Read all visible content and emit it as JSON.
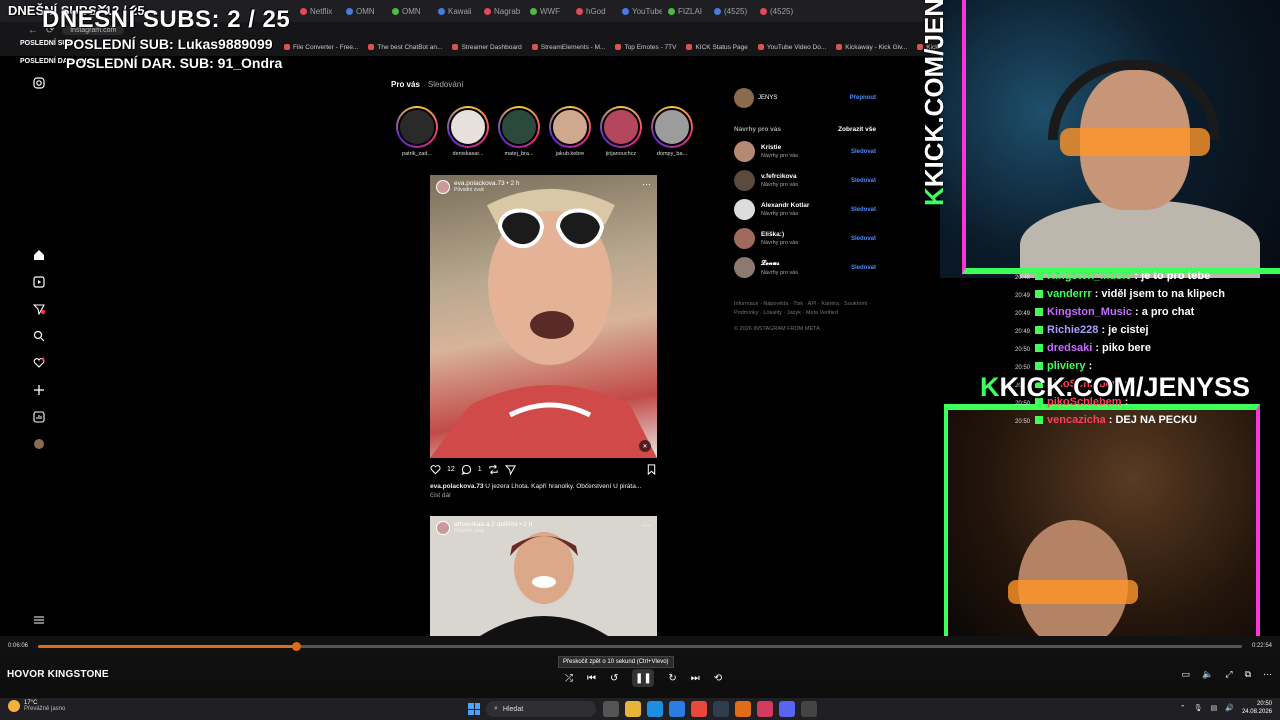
{
  "overlay": {
    "subs_small": "DNEŠNÍ SUBS: 12 / 25",
    "subs_big": "DNEŠNÍ SUBS: 2 / 25",
    "last_sub_label": "POSLEDNÍ SUB:",
    "last_sub_big": "POSLEDNÍ SUB: Lukas9889099",
    "last_gift_label": "POSLEDNÍ DAR. SUB:",
    "last_gift_big": "POSLEDNÍ DAR. SUB: 91_Ondra"
  },
  "browser": {
    "url": "instagram.com",
    "tabs": [
      "Netflix",
      "OMN",
      "OMN",
      "Kawaii",
      "Nagrab",
      "WWF",
      "hGod",
      "YouTube",
      "FIZLAI",
      "(4525)",
      "(4525)"
    ],
    "bookmarks": [
      "File Converter - Free...",
      "The best ChatBot an...",
      "Streamer Dashboard",
      "StreamElements - M...",
      "Top Emotes - 7TV",
      "KICK Status Page",
      "YouTube Video Do...",
      "Kickaway - Kick Giv...",
      "Kick / Twitch VOD d..."
    ]
  },
  "instagram": {
    "feed_tabs": {
      "for_you": "Pro vás",
      "following": "Sledování"
    },
    "stories": [
      {
        "name": "patrik_zad..."
      },
      {
        "name": "deniskasar..."
      },
      {
        "name": "matej_bra..."
      },
      {
        "name": "jakub.kebre"
      },
      {
        "name": "jirijanouchcz"
      },
      {
        "name": "dompy_ba..."
      }
    ],
    "post1": {
      "user": "eva.polackova.73",
      "time": "• 2 h",
      "audio": "Původní zvuk",
      "likes": "12",
      "comments": "1",
      "caption_user": "eva.polackova.73",
      "caption_text": "U jezera Lhota. Kapří hranolky. Občerstvení U piráta...",
      "read_more": "číst dál"
    },
    "post2": {
      "user": "athxenkaa",
      "with": "a 2 dalšími",
      "time": "• 2 h",
      "audio": "Původní zvuk"
    },
    "profile": {
      "name": "JENYS",
      "switch": "Přepnout"
    },
    "suggestions_title": "Návrhy pro vás",
    "see_all": "Zobrazit vše",
    "suggestions": [
      {
        "name": "Kristie",
        "sub": "Návrhy pro vás",
        "action": "Sledovat"
      },
      {
        "name": "v.fefrcikova",
        "sub": "Návrhy pro vás",
        "action": "Sledovat"
      },
      {
        "name": "Alexandr Kotlar",
        "sub": "Návrhy pro vás",
        "action": "Sledovat"
      },
      {
        "name": "Eliška:)",
        "sub": "Návrhy pro vás",
        "action": "Sledovat"
      },
      {
        "name": "𝓛𝓮𝓷𝓾𝓼",
        "sub": "Návrhy pro vás",
        "action": "Sledovat"
      }
    ],
    "footer_links": "Informace · Nápověda · Tisk · API · Kariéra · Soukromí · Podmínky · Lokality · Jazyk · Meta Verified",
    "copyright": "© 2026 INSTAGRAM FROM META"
  },
  "stream": {
    "kick_vertical": "KICK.COM/JENYSS",
    "kick_horizontal": "KICK.COM/JENYSS",
    "chat": [
      {
        "time": "20:48",
        "user": "Kingst0n_Music",
        "color": "#3dff5a",
        "text": ": je to pro tebe"
      },
      {
        "time": "20:49",
        "user": "vanderrr",
        "color": "#3dff5a",
        "text": ": viděl jsem to na klipech"
      },
      {
        "time": "20:49",
        "user": "Kingston_Music",
        "color": "#c86bff",
        "text": ": a pro chat"
      },
      {
        "time": "20:49",
        "user": "Richie228",
        "color": "#a8a0ff",
        "text": ": je cistej"
      },
      {
        "time": "20:50",
        "user": "dredsaki",
        "color": "#c86bff",
        "text": ": piko bere"
      },
      {
        "time": "20:50",
        "user": "pliviery",
        "color": "#3dff5a",
        "text": ":"
      },
      {
        "time": "20:50",
        "user": "pikoSchlebem",
        "color": "#ff3f5a",
        "text": ":"
      },
      {
        "time": "20:50",
        "user": "pikoSchlebem",
        "color": "#ff3f5a",
        "text": ":"
      },
      {
        "time": "20:50",
        "user": "vencazicha",
        "color": "#ff3f5a",
        "text": ": DEJ NA PECKU"
      }
    ]
  },
  "player": {
    "current_time": "0:06:06",
    "total_time": "0:22:54",
    "progress": 0.214,
    "title": "HOVOR KINGSTONE",
    "tooltip": "Přeskočit zpět o 10 sekund (Ctrl+Vlevo)"
  },
  "taskbar": {
    "temperature": "17°C",
    "weather": "Převážně jasno",
    "search_placeholder": "Hledat",
    "time": "20:50",
    "date": "24.08.2026"
  }
}
